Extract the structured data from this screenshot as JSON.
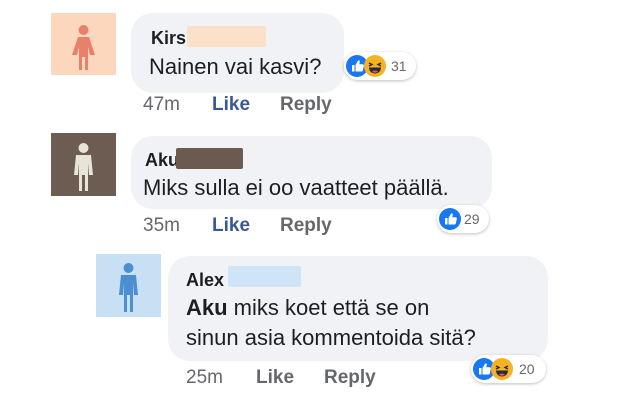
{
  "colors": {
    "like_blue": "#1877f2",
    "haha_yellow": "#f7b125",
    "link_blue": "#385898",
    "muted_grey": "#65676b",
    "bubble_grey": "#f0f2f5"
  },
  "comments": [
    {
      "author": "Kirsi",
      "avatar_icon": "female-figure-icon",
      "text": "Nainen vai kasvi?",
      "time": "47m",
      "like": "Like",
      "reply": "Reply",
      "reactions": [
        "like-reaction-icon",
        "haha-reaction-icon"
      ],
      "reaction_count": "31"
    },
    {
      "author": "Aku",
      "avatar_icon": "male-figure-icon",
      "text": "Miks sulla ei oo vaatteet päällä.",
      "time": "35m",
      "like": "Like",
      "reply": "Reply",
      "reactions": [
        "like-reaction-icon"
      ],
      "reaction_count": "29"
    }
  ],
  "reply": {
    "author": "Alex",
    "avatar_icon": "male-figure-icon",
    "mention": "Aku",
    "text_line1": " miks koet että se on",
    "text_line2": "sinun asia kommentoida sitä?",
    "time": "25m",
    "like": "Like",
    "reply": "Reply",
    "reactions": [
      "like-reaction-icon",
      "haha-reaction-icon"
    ],
    "reaction_count": "20"
  }
}
